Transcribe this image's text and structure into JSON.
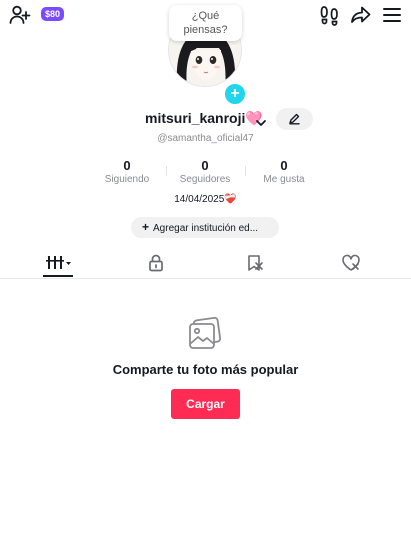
{
  "topbar": {
    "add_friend_icon": "person-plus-icon",
    "coin_badge_label": "$80",
    "footprints_icon": "footprints-icon",
    "share_icon": "share-arrow-icon",
    "menu_icon": "hamburger-menu-icon"
  },
  "note_bubble": {
    "line1": "¿Qué",
    "line2": "piensas?"
  },
  "profile": {
    "username": "mitsuri_kanroji🩷",
    "handle": "@samantha_oficial47",
    "bio": "14/04/2025❤️‍🩹"
  },
  "stats": [
    {
      "value": "0",
      "label": "Siguiendo"
    },
    {
      "value": "0",
      "label": "Seguidores"
    },
    {
      "value": "0",
      "label": "Me gusta"
    }
  ],
  "institution_button": {
    "plus": "+",
    "label": "Agregar institución ed..."
  },
  "tabs": [
    {
      "icon": "grid-icon",
      "active": true
    },
    {
      "icon": "lock-icon",
      "active": false
    },
    {
      "icon": "bookmark-icon",
      "active": false
    },
    {
      "icon": "liked-heart-icon",
      "active": false
    }
  ],
  "empty_state": {
    "icon": "photo-stack-icon",
    "title": "Comparte tu foto más popular",
    "button_label": "Cargar"
  },
  "colors": {
    "accent": "#fe2c55",
    "avatar_plus": "#20d5ec",
    "coin_badge": "#7b4bff",
    "text": "#161823",
    "secondary_text": "#8a8b91"
  }
}
